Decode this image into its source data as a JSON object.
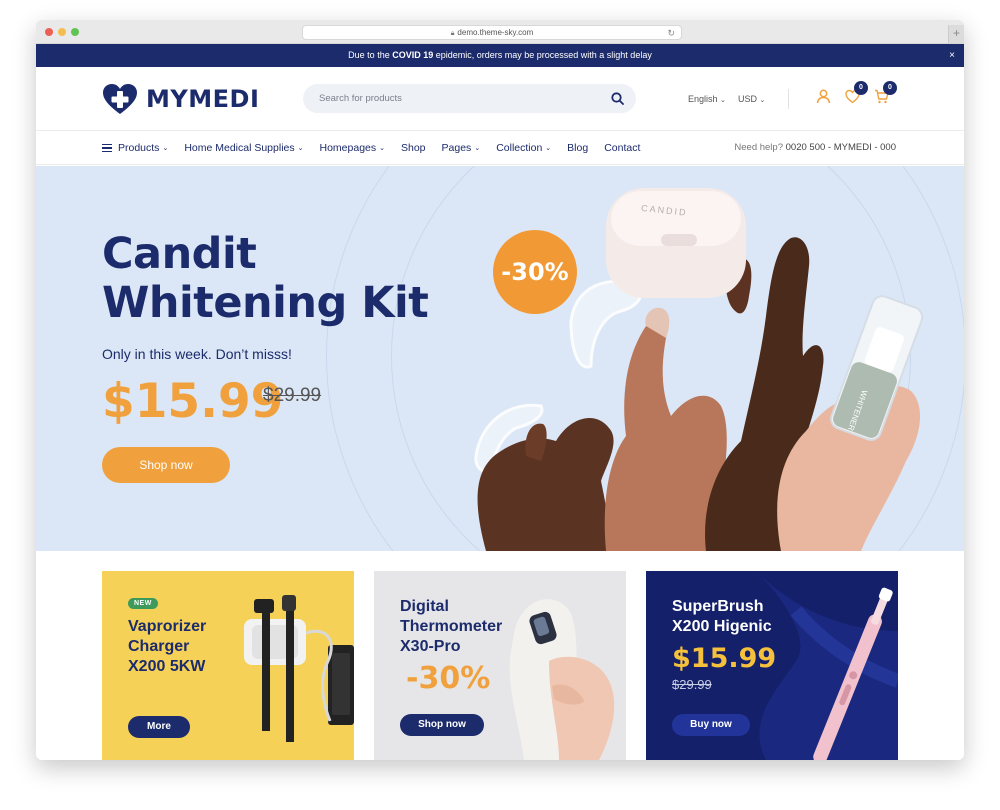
{
  "browser": {
    "url": "demo.theme-sky.com"
  },
  "promo": {
    "text_before": "Due to the ",
    "text_bold": "COVID 19",
    "text_after": " epidemic, orders may be processed with a slight delay",
    "close": "×"
  },
  "header": {
    "logo_text": "MYMEDI",
    "search_placeholder": "Search for products",
    "language": "English",
    "currency": "USD",
    "wishlist_count": "0",
    "cart_count": "0"
  },
  "nav": {
    "items": [
      "Products",
      "Home Medical Supplies",
      "Homepages",
      "Shop",
      "Pages",
      "Collection",
      "Blog",
      "Contact"
    ],
    "help_label": "Need help?",
    "help_phone": "0020 500 - MYMEDI - 000"
  },
  "hero": {
    "title_line1": "Candit",
    "title_line2": "Whitening Kit",
    "subtitle": "Only in this week. Don’t misss!",
    "price": "$15.99",
    "old_price": "$29.99",
    "button": "Shop now",
    "discount": "-30%",
    "case_label": "CANDID",
    "bottle_label": "WHITENER"
  },
  "cards": [
    {
      "tag": "NEW",
      "title": [
        "Vaprorizer",
        "Charger",
        "X200 5KW"
      ],
      "button": "More"
    },
    {
      "title": [
        "Digital",
        "Thermometer",
        "X30-Pro"
      ],
      "discount": "-30%",
      "button": "Shop now"
    },
    {
      "title": [
        "SuperBrush",
        "X200 Higenic"
      ],
      "price": "$15.99",
      "old_price": "$29.99",
      "button": "Buy now"
    }
  ],
  "colors": {
    "navy": "#1c2b6b",
    "orange": "#f0a13d",
    "hero_bg": "#dbe7f6",
    "card1_bg": "#f5d257",
    "card2_bg": "#e6e6e8",
    "card3_bg": "#14206a"
  }
}
